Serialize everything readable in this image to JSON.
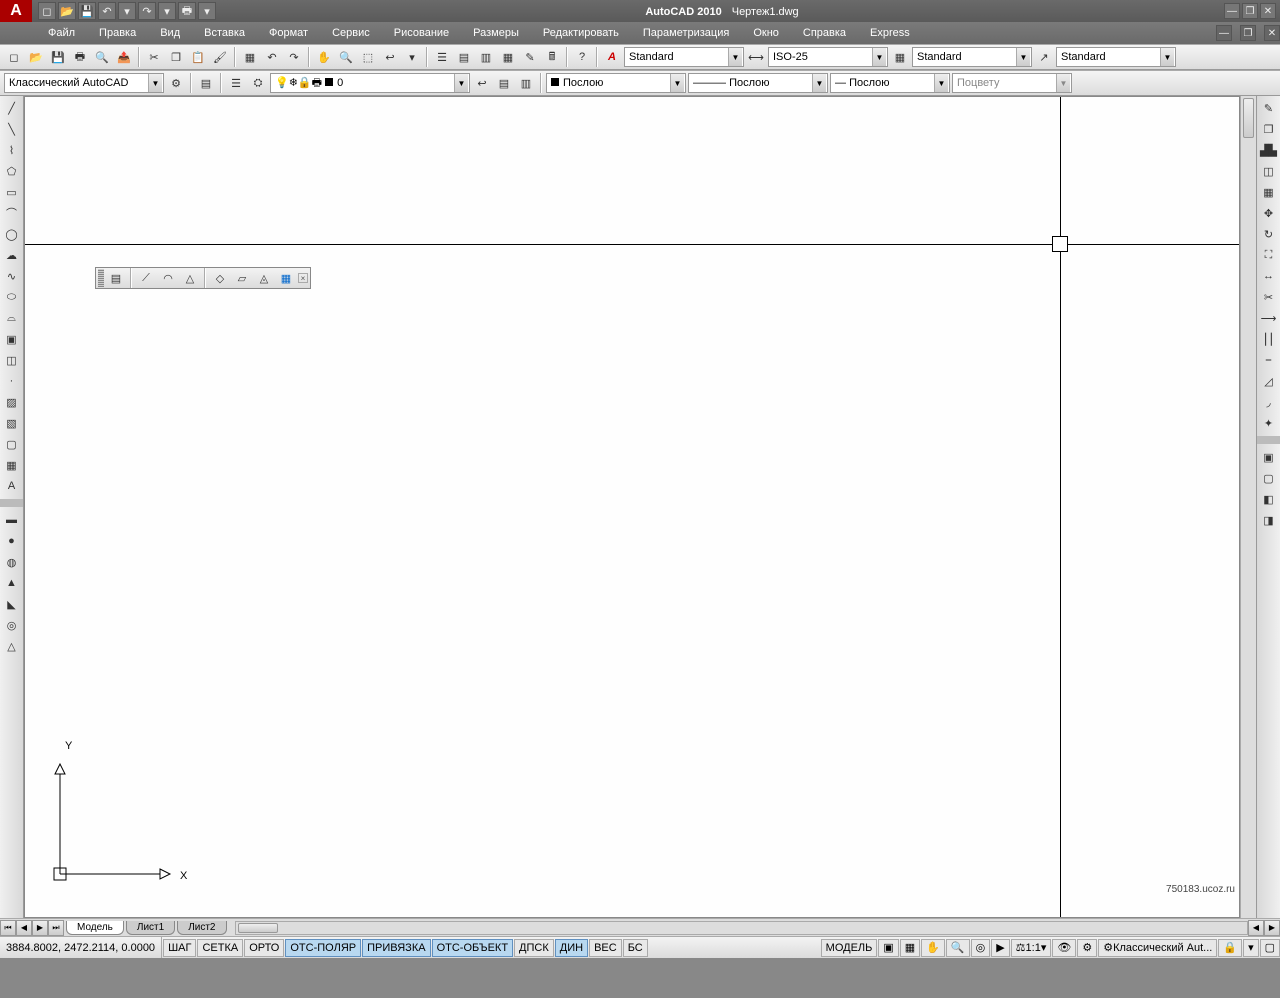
{
  "title": {
    "app": "AutoCAD 2010",
    "doc": "Чертеж1.dwg"
  },
  "menu": [
    "Файл",
    "Правка",
    "Вид",
    "Вставка",
    "Формат",
    "Сервис",
    "Рисование",
    "Размеры",
    "Редактировать",
    "Параметризация",
    "Окно",
    "Справка",
    "Express"
  ],
  "styles": {
    "text_style": "Standard",
    "dim_style": "ISO-25",
    "table_style": "Standard",
    "mleader_style": "Standard"
  },
  "layers": {
    "workspace": "Классический AutoCAD",
    "layer": "0",
    "linetype": "Послою",
    "lineweight": "Послою",
    "plotstyle": "Послою",
    "color": "Поцвету"
  },
  "tabs": {
    "model": "Модель",
    "sheet1": "Лист1",
    "sheet2": "Лист2"
  },
  "status": {
    "coords": "3884.8002, 2472.2114, 0.0000",
    "toggles": [
      "ШАГ",
      "СЕТКА",
      "ОРТО",
      "ОТС-ПОЛЯР",
      "ПРИВЯЗКА",
      "ОТС-ОБЪЕКТ",
      "ДПСК",
      "ДИН",
      "ВЕС",
      "БС"
    ],
    "active_toggles": [
      "ОТС-ПОЛЯР",
      "ПРИВЯЗКА",
      "ОТС-ОБЪЕКТ",
      "ДИН"
    ],
    "model_button": "МОДЕЛЬ",
    "scale": "1:1",
    "workspace_label": "Классический Aut...",
    "watermark": "750183.ucoz.ru"
  },
  "ucs": {
    "x": "X",
    "y": "Y"
  }
}
